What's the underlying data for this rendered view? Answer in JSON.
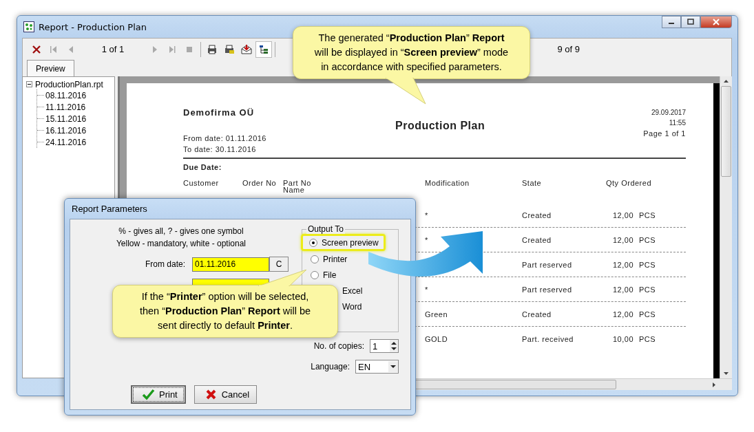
{
  "window": {
    "title": "Report - Production Plan"
  },
  "toolbar": {
    "page_counter": "1 of 1",
    "total_counter": "9 of 9"
  },
  "tabs": [
    {
      "label": "Preview",
      "selected": true
    }
  ],
  "tree": {
    "label": "ProductionPlan.rpt",
    "expanded": true,
    "children": [
      {
        "label": "08.11.2016"
      },
      {
        "label": "11.11.2016"
      },
      {
        "label": "15.11.2016"
      },
      {
        "label": "16.11.2016"
      },
      {
        "label": "24.11.2016"
      }
    ]
  },
  "report": {
    "company": "Demofirma OÜ",
    "title": "Production Plan",
    "date": "29.09.2017",
    "time": "11:55",
    "page": "Page 1 of 1",
    "from_date": "From date: 01.11.2016",
    "to_date": "To date: 30.11.2016",
    "group_label": "Due Date:",
    "columns": [
      {
        "label": "Customer"
      },
      {
        "label": "Order No"
      },
      {
        "label": "Part No",
        "second_line": "Name"
      },
      {
        "label": "Modification"
      },
      {
        "label": "State"
      },
      {
        "label": "Qty Ordered"
      }
    ],
    "rows": [
      {
        "modification": "*",
        "state": "Created",
        "qty": "12,00",
        "unit": "PCS"
      },
      {
        "modification": "*",
        "state": "Created",
        "qty": "12,00",
        "unit": "PCS"
      },
      {
        "state": "Part reserved",
        "qty": "12,00",
        "unit": "PCS"
      },
      {
        "modification": "*",
        "state": "Part reserved",
        "qty": "12,00",
        "unit": "PCS"
      },
      {
        "modification": "Green",
        "state": "Created",
        "qty": "12,00",
        "unit": "PCS"
      },
      {
        "modification": "GOLD",
        "state": "Part. received",
        "qty": "10,00",
        "unit": "PCS"
      }
    ]
  },
  "dialog": {
    "title": "Report Parameters",
    "hint_lines": [
      "% - gives all, ? - gives one symbol",
      "Yellow - mandatory, white - optional"
    ],
    "from_date": {
      "label": "From date:",
      "value": "01.11.2016",
      "button": "C"
    },
    "output_to": {
      "legend": "Output To",
      "options": [
        {
          "label": "Screen preview",
          "selected": true,
          "highlighted": true
        },
        {
          "label": "Printer",
          "selected": false,
          "highlighted": false
        },
        {
          "label": "File",
          "selected": false,
          "highlighted": false
        },
        {
          "label": "Excel",
          "highlighted": false
        },
        {
          "label": "Word",
          "highlighted": false
        }
      ]
    },
    "copies": {
      "label": "No. of copies:",
      "value": "1"
    },
    "language": {
      "label": "Language:",
      "value": "EN"
    },
    "buttons": [
      {
        "label": "Print",
        "kind": "ok"
      },
      {
        "label": "Cancel",
        "kind": "cancel"
      }
    ]
  },
  "callouts": [
    {
      "kind": "down",
      "lines": [
        "The generated “**Production Plan**” **Report**",
        "will be displayed in “**Screen preview**” mode",
        "in accordance with specified parameters."
      ]
    },
    {
      "kind": "up",
      "lines": [
        "If the “**Printer**” option will be selected,",
        "then “**Production Plan**” **Report** will be",
        "sent directly to default **Printer**."
      ]
    }
  ]
}
